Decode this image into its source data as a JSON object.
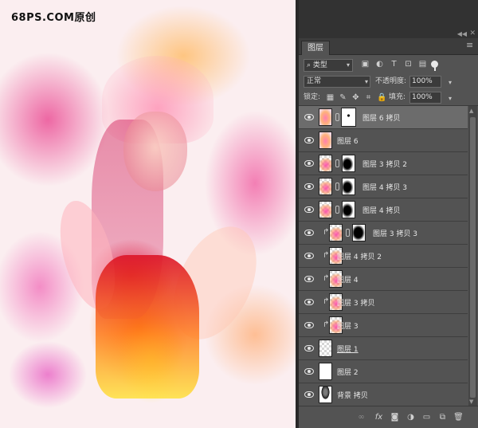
{
  "canvas": {
    "watermark": "68PS.COM原创"
  },
  "panel": {
    "tab_label": "图层",
    "filter": {
      "kind_label": "类型",
      "icons": [
        "pixel-filter-icon",
        "adjustment-filter-icon",
        "type-filter-icon",
        "shape-filter-icon",
        "smart-object-filter-icon"
      ]
    },
    "blend": {
      "mode": "正常",
      "opacity_label": "不透明度:",
      "opacity_value": "100%"
    },
    "lock": {
      "label": "锁定:",
      "fill_label": "填充:",
      "fill_value": "100%"
    },
    "layers": [
      {
        "name": "图层 6 拷贝",
        "selected": true,
        "clipped": false,
        "thumb": "color",
        "mask": "sel"
      },
      {
        "name": "图层 6",
        "selected": false,
        "clipped": false,
        "thumb": "color",
        "mask": null
      },
      {
        "name": "图层 3 拷贝 2",
        "selected": false,
        "clipped": false,
        "thumb": "checker-paint",
        "mask": "dark"
      },
      {
        "name": "图层 4 拷贝 3",
        "selected": false,
        "clipped": false,
        "thumb": "checker-paint",
        "mask": "dark"
      },
      {
        "name": "图层 4 拷贝",
        "selected": false,
        "clipped": false,
        "thumb": "checker-paint",
        "mask": "dark"
      },
      {
        "name": "图层 3 拷贝 3",
        "selected": false,
        "clipped": true,
        "thumb": "checker-paint",
        "mask": "darker"
      },
      {
        "name": "图层 4 拷贝 2",
        "selected": false,
        "clipped": true,
        "thumb": "checker-paint",
        "mask": null
      },
      {
        "name": "图层 4",
        "selected": false,
        "clipped": true,
        "thumb": "checker-paint",
        "mask": null
      },
      {
        "name": "图层 3 拷贝",
        "selected": false,
        "clipped": true,
        "thumb": "checker-paint",
        "mask": null
      },
      {
        "name": "图层 3",
        "selected": false,
        "clipped": true,
        "thumb": "checker-paint",
        "mask": null
      },
      {
        "name": "图层 1",
        "selected": false,
        "clipped": false,
        "thumb": "checker",
        "mask": null,
        "underline": true
      },
      {
        "name": "图层 2",
        "selected": false,
        "clipped": false,
        "thumb": "white",
        "mask": null
      },
      {
        "name": "背景 拷贝",
        "selected": false,
        "clipped": false,
        "thumb": "photo",
        "mask": null
      }
    ],
    "bottom_icons": [
      "link-layers-icon",
      "fx-icon",
      "add-mask-icon",
      "adjustment-layer-icon",
      "new-group-icon",
      "new-layer-icon",
      "delete-layer-icon"
    ],
    "fx_label": "fx"
  }
}
